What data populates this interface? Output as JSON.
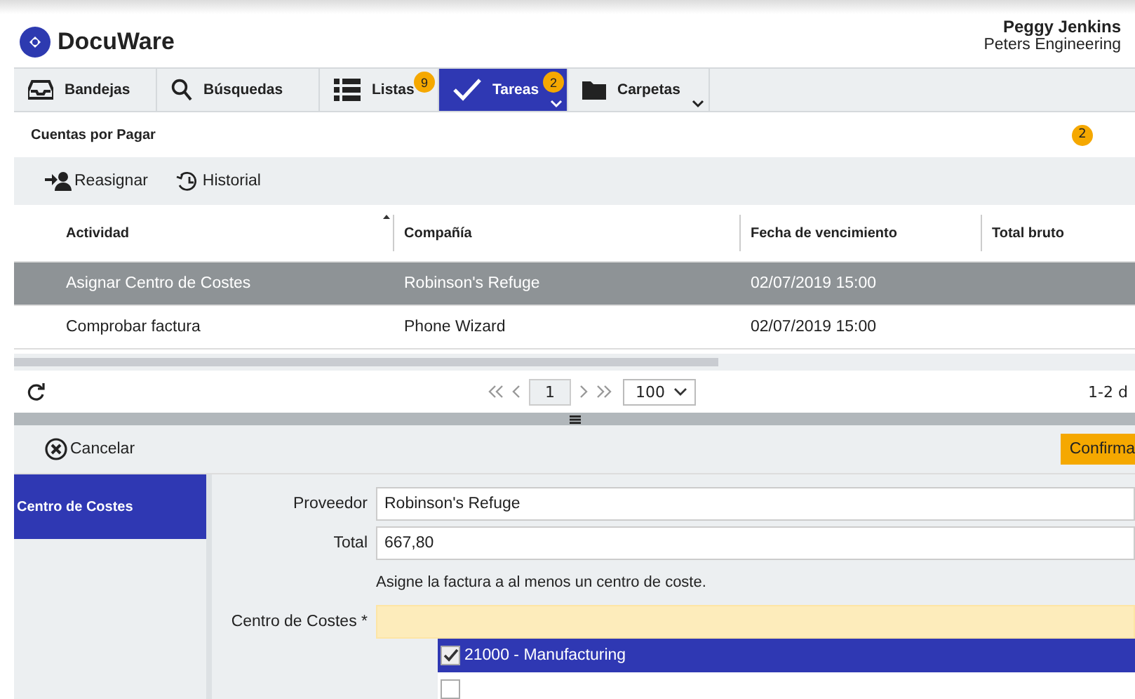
{
  "app": {
    "logo": "DocuWare",
    "user_name": "Peggy Jenkins",
    "company": "Peters Engineering"
  },
  "tabs": [
    {
      "label": "Bandejas",
      "kind": "tray",
      "selected": false
    },
    {
      "label": "Búsquedas",
      "kind": "search",
      "selected": false
    },
    {
      "label": "Listas",
      "kind": "list",
      "badge": "9",
      "selected": false
    },
    {
      "label": "Tareas",
      "kind": "check",
      "badge": "2",
      "dropdown": true,
      "selected": true
    },
    {
      "label": "Carpetas",
      "kind": "folder",
      "dropdown": true,
      "selected": false
    }
  ],
  "list_title": "Cuentas por Pagar",
  "list_badge": "2",
  "toolbar": [
    {
      "label": "Reasignar",
      "kind": "reassign"
    },
    {
      "label": "Historial",
      "kind": "history"
    }
  ],
  "table": {
    "columns": [
      {
        "label": "Actividad",
        "sorted": true
      },
      {
        "label": "Compañía",
        "sorted": false
      },
      {
        "label": "Fecha de vencimiento",
        "sorted": false
      },
      {
        "label": "Total bruto",
        "sorted": false
      }
    ],
    "rows": [
      {
        "cells": [
          "Asignar Centro de Costes",
          "Robinson's Refuge",
          "02/07/2019 15:00"
        ],
        "selected": true
      },
      {
        "cells": [
          "Comprobar factura",
          "Phone Wizard",
          "02/07/2019 15:00"
        ],
        "selected": false
      }
    ]
  },
  "pager": {
    "page": "1",
    "page_size": "100",
    "count": "1-2 d"
  },
  "actions": {
    "cancel": "Cancelar",
    "confirm": "Confirma"
  },
  "side_nav": [
    {
      "label": "Centro de Costes",
      "selected": true
    }
  ],
  "form": {
    "fields": [
      {
        "label": "Proveedor",
        "value": "Robinson's Refuge"
      },
      {
        "label": "Total",
        "value": "667,80"
      }
    ],
    "hint": "Asigne la factura a al menos un centro de coste.",
    "cost_center": {
      "label": "Centro de Costes *",
      "options": [
        {
          "label": "21000 - Manufacturing",
          "checked": true
        },
        {
          "checked": false
        }
      ]
    }
  }
}
